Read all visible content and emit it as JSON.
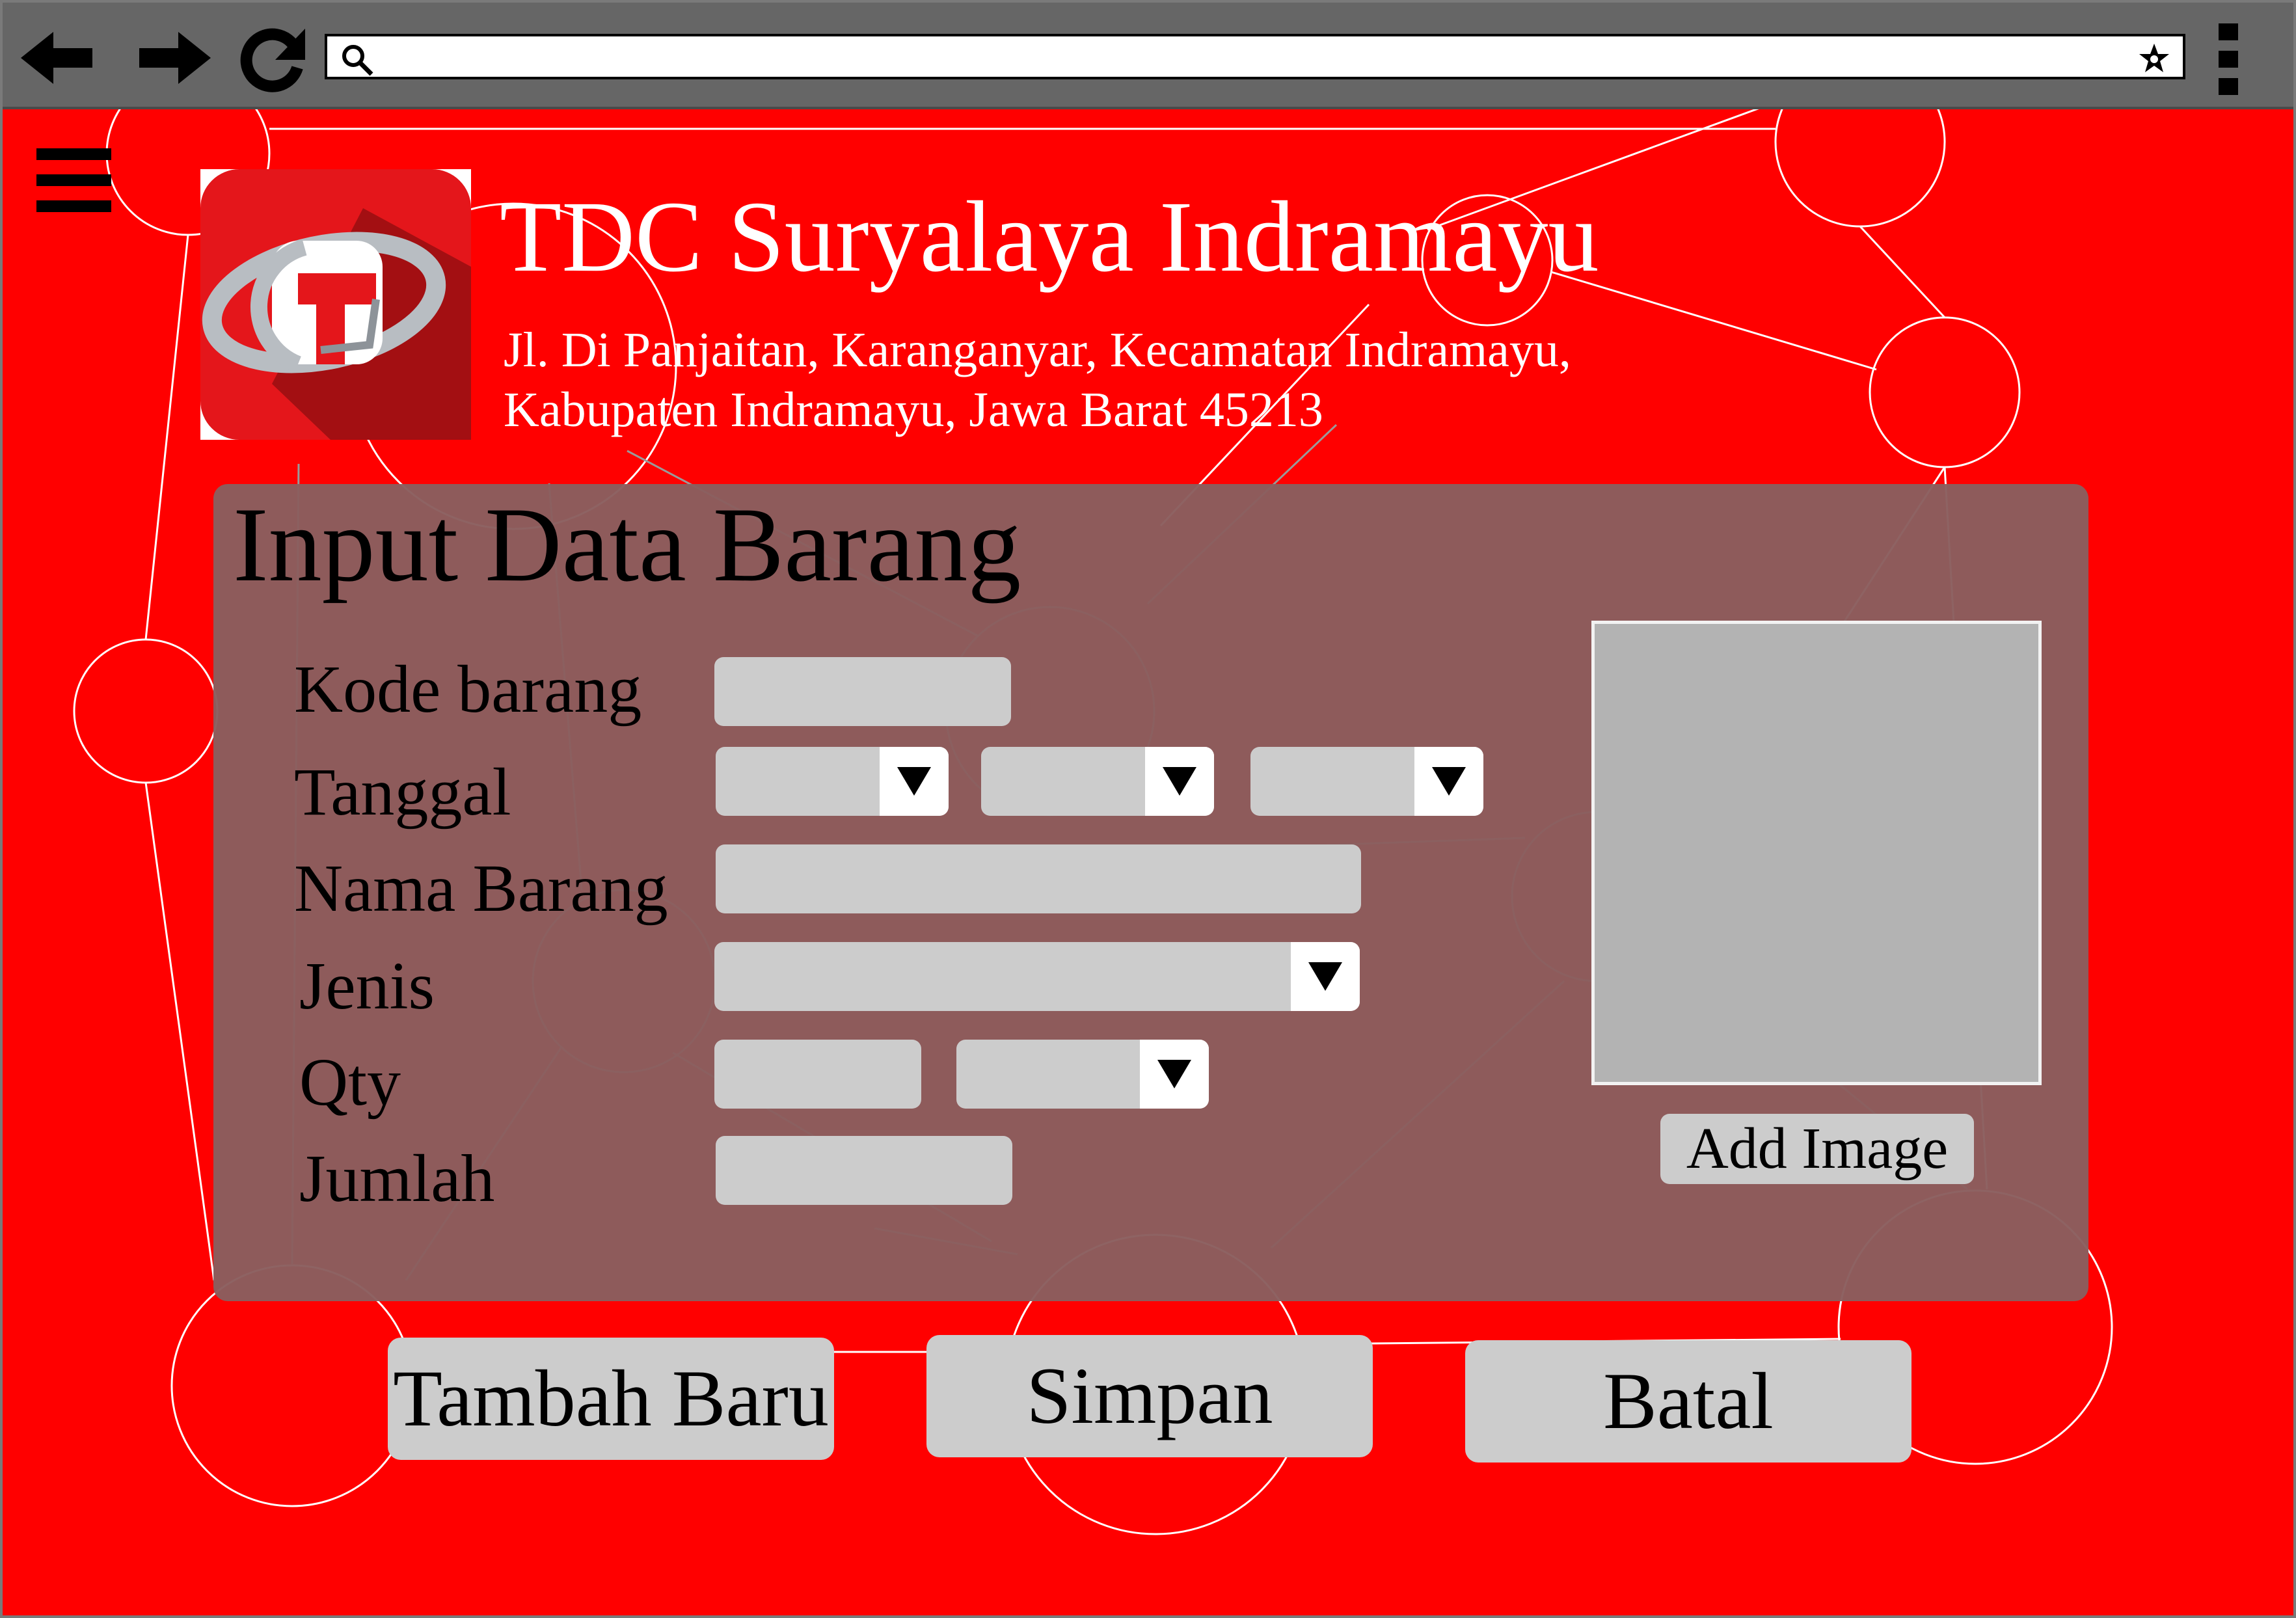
{
  "browser": {
    "back_icon": "back-arrow-icon",
    "forward_icon": "forward-arrow-icon",
    "reload_icon": "reload-icon",
    "search_icon": "search-icon",
    "bookmark_icon": "star-icon",
    "menu_icon": "kebab-menu-icon",
    "url": ""
  },
  "header": {
    "menu_icon": "hamburger-icon",
    "logo": "telkom-logo",
    "title": "TDC Suryalaya Indramayu",
    "address_line1": "Jl. Di Panjaitan, Karanganyar, Kecamatan Indramayu,",
    "address_line2": "Kabupaten Indramayu, Jawa Barat 45213"
  },
  "form": {
    "title": "Input Data Barang",
    "fields": {
      "kode_barang": {
        "label": "Kode barang",
        "value": ""
      },
      "tanggal": {
        "label": "Tanggal",
        "day": "",
        "month": "",
        "year": ""
      },
      "nama_barang": {
        "label": "Nama Barang",
        "value": ""
      },
      "jenis": {
        "label": "Jenis",
        "value": ""
      },
      "qty": {
        "label": "Qty",
        "value": "",
        "unit": ""
      },
      "jumlah": {
        "label": "Jumlah",
        "value": ""
      }
    },
    "add_image_label": "Add Image"
  },
  "actions": {
    "tambah_baru": "Tambah Baru",
    "simpan": "Simpan",
    "batal": "Batal"
  },
  "colors": {
    "background": "#ff0000",
    "panel": "#8a5e5e",
    "input": "#cccccc",
    "toolbar": "#666666"
  }
}
